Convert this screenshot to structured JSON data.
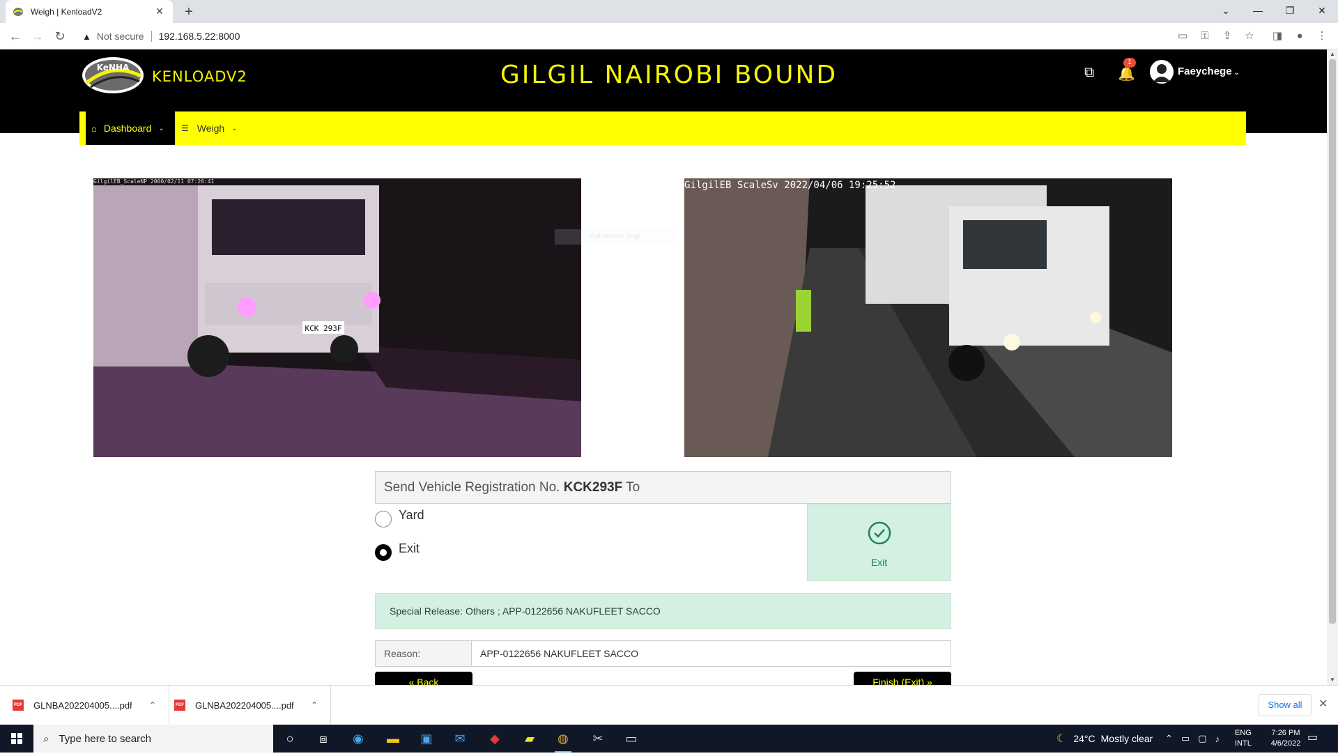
{
  "browser": {
    "tab_title": "Weigh | KenloadV2",
    "new_tab": "+",
    "close_tab": "✕",
    "security_label": "Not secure",
    "url": "192.168.5.22:8000"
  },
  "header": {
    "logo_text": "KeNHA",
    "brand": "KENLOADV2",
    "station_title": "GILGIL NAIROBI BOUND",
    "notification_count": "1",
    "username": "Faeychege"
  },
  "nav": {
    "dashboard": "Dashboard",
    "weigh": "Weigh"
  },
  "cameras": {
    "front_stamp": "GilgilEB_ScaleNP 2000/02/11 07:26:41",
    "side_stamp": "GilgilEB  ScaleSv 2022/04/06 19:25:52",
    "front_plate": "KCK 293F",
    "snip_hint": "Full-screen Snip"
  },
  "send": {
    "prefix": "Send Vehicle Registration No. ",
    "plate": "KCK293F",
    "suffix": " To",
    "options": [
      "Yard",
      "Exit"
    ],
    "selected": "Exit",
    "status_label": "Exit"
  },
  "release": {
    "text": "Special Release: Others ; APP-0122656 NAKUFLEET SACCO"
  },
  "reason": {
    "label": "Reason:",
    "value": "APP-0122656 NAKUFLEET SACCO"
  },
  "buttons": {
    "back": "« Back",
    "finish": "Finish (Exit) »"
  },
  "downloads": {
    "files": [
      "GLNBA202204005....pdf",
      "GLNBA202204005....pdf"
    ],
    "show_all": "Show all"
  },
  "taskbar": {
    "search_placeholder": "Type here to search",
    "temperature": "24°C",
    "weather": "Mostly clear",
    "lang_top": "ENG",
    "lang_bottom": "INTL",
    "time": "7:26 PM",
    "date": "4/6/2022"
  },
  "colors": {
    "header_bg": "#000000",
    "accent_yellow": "#ffff00",
    "success_bg": "#d4f0e3",
    "success_text": "#198754"
  }
}
